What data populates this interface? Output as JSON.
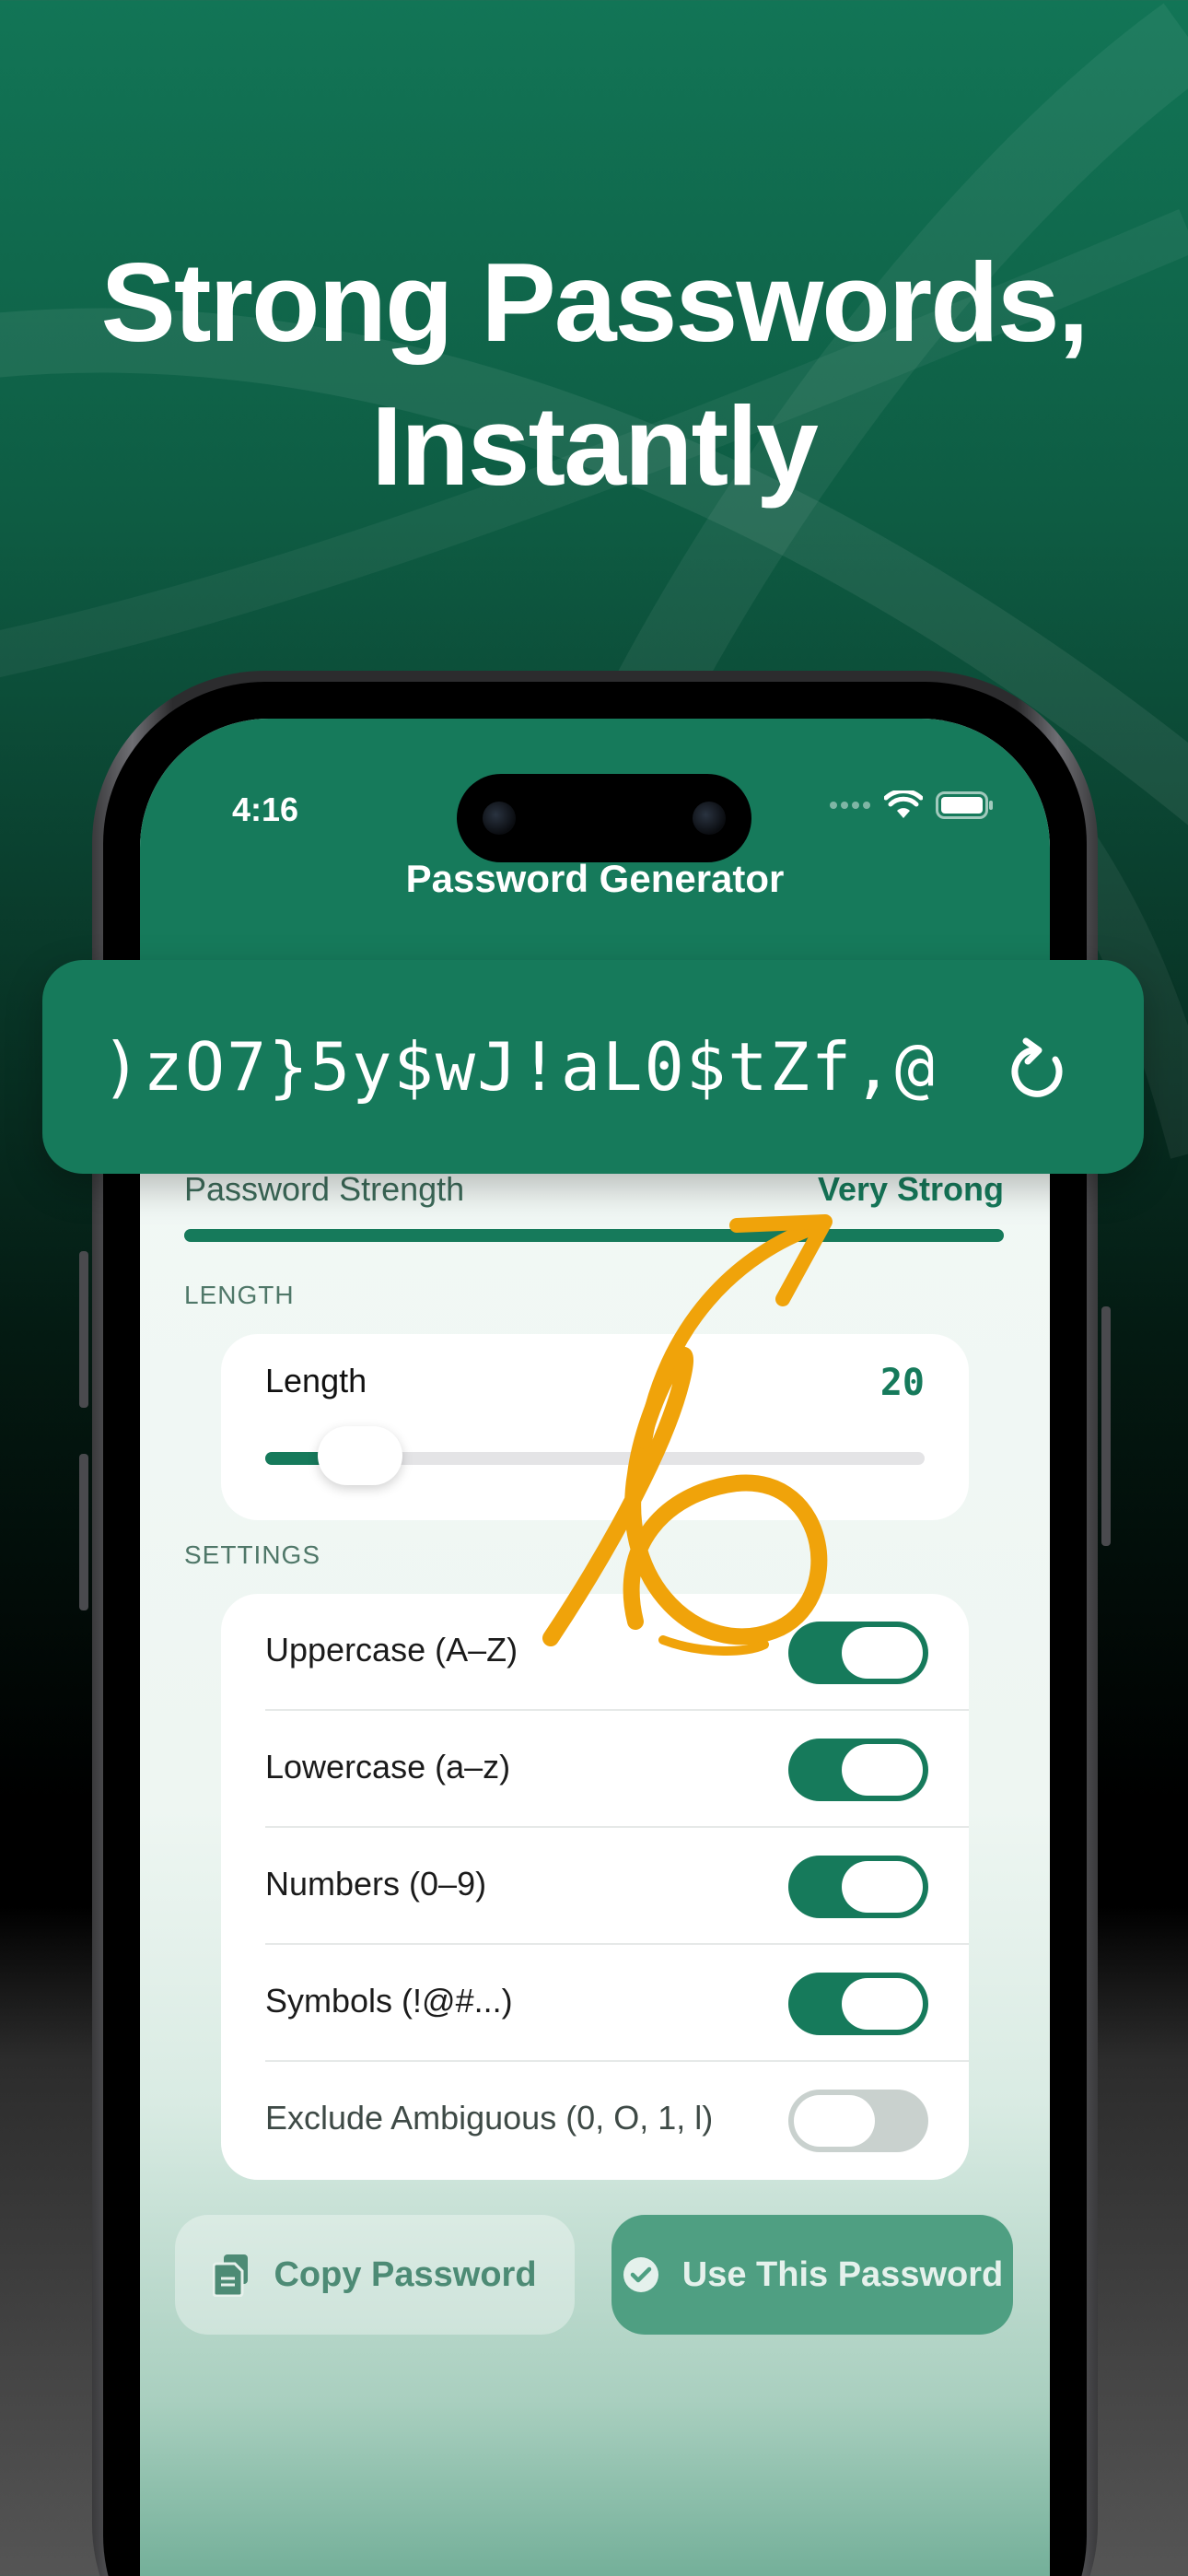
{
  "headline": {
    "line1": "Strong Passwords,",
    "line2": "Instantly"
  },
  "status_bar": {
    "time": "4:16"
  },
  "nav": {
    "title": "Password Generator"
  },
  "password": {
    "value": ")zO7}5y$wJ!aL0$tZf,@",
    "refresh_icon": "refresh-icon"
  },
  "strength": {
    "label": "Password Strength",
    "value": "Very Strong",
    "level": 1.0
  },
  "length_section": {
    "header": "LENGTH",
    "label": "Length",
    "value": "20",
    "slider_fraction": 0.08
  },
  "settings_section": {
    "header": "SETTINGS",
    "items": [
      {
        "label": "Uppercase (A–Z)",
        "on": true
      },
      {
        "label": "Lowercase (a–z)",
        "on": true
      },
      {
        "label": "Numbers (0–9)",
        "on": true
      },
      {
        "label": "Symbols (!@#...)",
        "on": true
      },
      {
        "label": "Exclude Ambiguous (0, O, 1, l)",
        "on": false
      }
    ]
  },
  "buttons": {
    "copy_label": "Copy Password",
    "use_label": "Use This Password"
  },
  "colors": {
    "brand_green": "#167a5b",
    "accent_arrow": "#f0a30a"
  }
}
